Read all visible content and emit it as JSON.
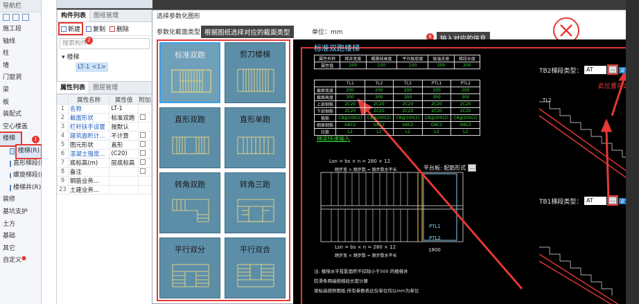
{
  "nav": {
    "title": "导航栏",
    "items": [
      "施工段",
      "轴线",
      "柱",
      "墙",
      "门窗洞",
      "梁",
      "板",
      "装配式",
      "空心楼盖",
      "楼梯"
    ],
    "subitems": [
      "楼梯(R)",
      "直形梯段(R)",
      "螺旋梯段(R)",
      "楼梯井(R)"
    ],
    "items_after": [
      "装修",
      "基坑支护",
      "土方",
      "基础",
      "其它",
      "自定义"
    ]
  },
  "comp": {
    "tab_active": "构件列表",
    "tab_other": "图纸管理",
    "new_label": "新建",
    "copy_label": "复制",
    "delete_label": "删除",
    "search_placeholder": "搜索构件...",
    "tree_root": "楼梯",
    "tree_leaf": "LT-1 <1>",
    "badge1": "1",
    "badge2": "2"
  },
  "props": {
    "tab_active": "属性列表",
    "tab_other": "图层管理",
    "headers": [
      "",
      "属性名称",
      "属性值",
      "附加"
    ],
    "rows": [
      {
        "n": "1",
        "name": "名称",
        "value": "LT-1",
        "cb": false,
        "blue": true
      },
      {
        "n": "2",
        "name": "截面形状",
        "value": "标准双跑",
        "cb": true,
        "blue": true
      },
      {
        "n": "3",
        "name": "栏杆扶手设置",
        "value": "按默认",
        "cb": false,
        "blue": true
      },
      {
        "n": "4",
        "name": "建筑面积计...",
        "value": "不计算",
        "cb": true,
        "blue": true
      },
      {
        "n": "5",
        "name": "图元形状",
        "value": "直形",
        "cb": true,
        "blue": false
      },
      {
        "n": "6",
        "name": "混凝土强度...",
        "value": "(C20)",
        "cb": true,
        "blue": true
      },
      {
        "n": "7",
        "name": "底标高(m)",
        "value": "层底标高",
        "cb": true,
        "blue": false
      },
      {
        "n": "8",
        "name": "备注",
        "value": "",
        "cb": true,
        "blue": false
      },
      {
        "n": "9",
        "name": "钢筋业务...",
        "value": "",
        "cb": false,
        "blue": false
      },
      {
        "n": "23",
        "name": "土建业务...",
        "value": "",
        "cb": false,
        "blue": false
      }
    ]
  },
  "dialog": {
    "title": "选择参数化图形",
    "subtitle": "参数化截面类型",
    "unit": "单位：mm",
    "callout3": "根据图纸选择对应的截面类型",
    "callout4": "输入对应的信息",
    "badge3": "3",
    "badge4": "4",
    "types": [
      "标准双跑",
      "剪刀楼梯",
      "直形双跑",
      "直形单跑",
      "转角双跑",
      "转角三跑",
      "平行双分",
      "平行双合"
    ]
  },
  "cad": {
    "title": "标准双跑楼梯",
    "link": "梯梁快速输入",
    "table1": {
      "header": [
        "属性名称",
        "梯井宽度",
        "踢脚线高度",
        "平台板厚度",
        "板端支座",
        "梯段长度"
      ],
      "row": [
        "属性值",
        "200",
        "100",
        "100",
        "200",
        "200"
      ]
    },
    "table2": {
      "header": [
        "",
        "TL1",
        "TL2",
        "TL3",
        "PTL1",
        "PTL2"
      ],
      "rows": [
        [
          "截面宽度",
          "200",
          "200",
          "200",
          "200",
          "200"
        ],
        [
          "截面高度",
          "300",
          "300",
          "300",
          "300",
          "300"
        ],
        [
          "上部钢筋",
          "2C20",
          "2C20",
          "2C20",
          "2C20",
          "2C20"
        ],
        [
          "下部钢筋",
          "2C20",
          "2C20",
          "2C20",
          "2C20",
          "2C20"
        ],
        [
          "箍筋",
          "C8@200(2)",
          "C8@200(2)",
          "C8@200(2)",
          "C8@200(2)",
          "C8@200(2)"
        ],
        [
          "侧面钢筋",
          "G6C2",
          "G6C2",
          "G6C2",
          "G6C2",
          "G6C2"
        ],
        [
          "拉筋",
          "L2",
          "L2",
          "L2",
          "L2",
          "L2"
        ]
      ]
    },
    "dim_top": "Lsn = bs × n = 280 × 12",
    "dim_top2": "踏步宽 × 踏步数 = 踏步数水平长",
    "dim_bot": "Lsn = bs × n = 280 × 12",
    "dim_bot2": "踏步宽 × 踏步数 = 踏步数水平长",
    "dim_1800": "1800",
    "platform": "平台板: 配筋形式",
    "platform_btn": "...",
    "tl2": "TL2",
    "ptl1": "PTL1",
    "ptl2": "PTL2",
    "notes": [
      "注: 楼梯水平投影面积不扣除小于500 的楼梯井",
      "    防滑条两端按梯段长度计算",
      "    梁标高按照图纸:所有参数表达仅单位均以mm为单位"
    ],
    "tb2_label": "TB2梯段类型：",
    "tb2_value": "AT",
    "tb1_label": "TB1梯段类型：",
    "tb1_value": "AT",
    "dots": "...",
    "red_hint": "此位置可选择",
    "tag": "梁下选择"
  }
}
